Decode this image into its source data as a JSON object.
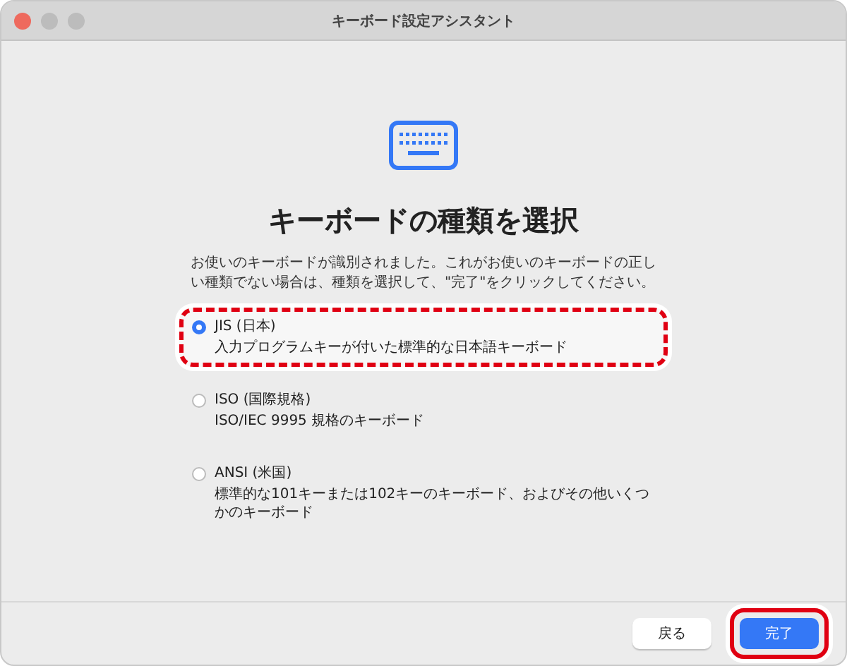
{
  "window": {
    "title": "キーボード設定アシスタント"
  },
  "heading": "キーボードの種類を選択",
  "description": "お使いのキーボードが識別されました。これがお使いのキーボードの正しい種類でない場合は、種類を選択して、\"完了\"をクリックしてください。",
  "options": [
    {
      "label": "JIS (日本)",
      "detail": "入力プログラムキーが付いた標準的な日本語キーボード",
      "selected": true,
      "highlighted": true
    },
    {
      "label": "ISO (国際規格)",
      "detail": "ISO/IEC 9995 規格のキーボード",
      "selected": false,
      "highlighted": false
    },
    {
      "label": "ANSI (米国)",
      "detail": "標準的な101キーまたは102キーのキーボード、およびその他いくつかのキーボード",
      "selected": false,
      "highlighted": false
    }
  ],
  "buttons": [
    {
      "label": "戻る",
      "kind": "secondary",
      "highlighted": false
    },
    {
      "label": "完了",
      "kind": "primary",
      "highlighted": true
    }
  ]
}
